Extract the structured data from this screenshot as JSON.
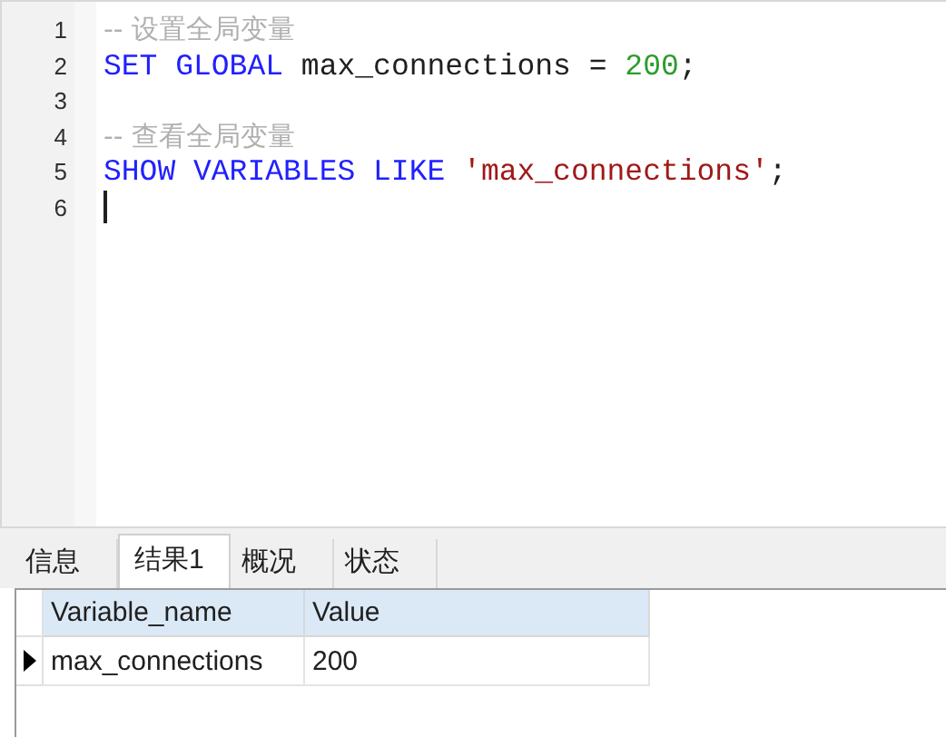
{
  "editor": {
    "lines": [
      {
        "number": "1",
        "caret": false,
        "tokens": [
          {
            "kind": "comment",
            "text": "-- 设置全局变量"
          }
        ]
      },
      {
        "number": "2",
        "caret": false,
        "tokens": [
          {
            "kind": "keyword",
            "text": "SET GLOBAL"
          },
          {
            "kind": "plain",
            "text": " max_connections = "
          },
          {
            "kind": "number",
            "text": "200"
          },
          {
            "kind": "plain",
            "text": ";"
          }
        ]
      },
      {
        "number": "3",
        "caret": false
      },
      {
        "number": "4",
        "caret": false,
        "tokens": [
          {
            "kind": "comment",
            "text": "-- 查看全局变量"
          }
        ]
      },
      {
        "number": "5",
        "caret": false,
        "tokens": [
          {
            "kind": "keyword",
            "text": "SHOW VARIABLES LIKE "
          },
          {
            "kind": "string",
            "text": "'max_connections'"
          },
          {
            "kind": "plain",
            "text": ";"
          }
        ]
      },
      {
        "number": "6",
        "caret": true
      }
    ]
  },
  "tabs": [
    {
      "label": "信息",
      "selected": false
    },
    {
      "label": "结果1",
      "selected": true
    },
    {
      "label": "概况",
      "selected": false
    },
    {
      "label": "状态",
      "selected": false
    }
  ],
  "table": {
    "columns": [
      "Variable_name",
      "Value"
    ],
    "rows": [
      {
        "selected": true,
        "cells": [
          "max_connections",
          "200"
        ]
      }
    ]
  }
}
